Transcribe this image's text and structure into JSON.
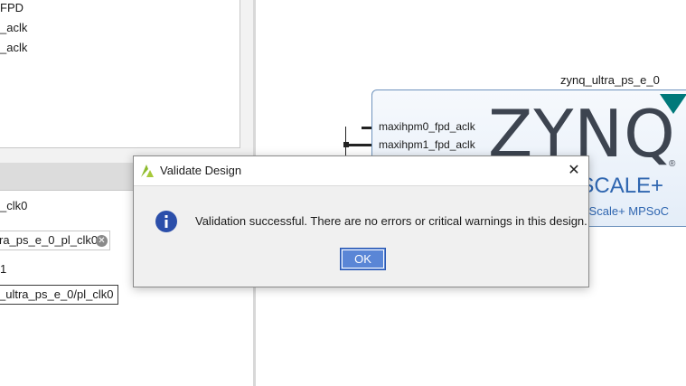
{
  "left_panel": {
    "tree_items": [
      "FPD",
      "_aclk",
      "_aclk"
    ],
    "props": {
      "row1_text": "_clk0",
      "field1_value": "ra_ps_e_0_pl_clk0",
      "row3_text": "1",
      "field2_value": "_ultra_ps_e_0/pl_clk0"
    }
  },
  "diagram": {
    "ip_instance_name": "zynq_ultra_ps_e_0",
    "ports": [
      "maxihpm0_fpd_aclk",
      "maxihpm1_fpd_aclk"
    ],
    "logo_text": "ZYNQ",
    "logo_reg": "®",
    "logo_sub": "aSCALE+",
    "subtitle": "raScale+ MPSoC"
  },
  "dialog": {
    "title": "Validate Design",
    "message": "Validation successful. There are no errors or critical warnings in this design.",
    "ok_label": "OK",
    "close_glyph": "✕",
    "info_icon_color": "#2c4faa",
    "ok_color": "#5a86d6"
  }
}
